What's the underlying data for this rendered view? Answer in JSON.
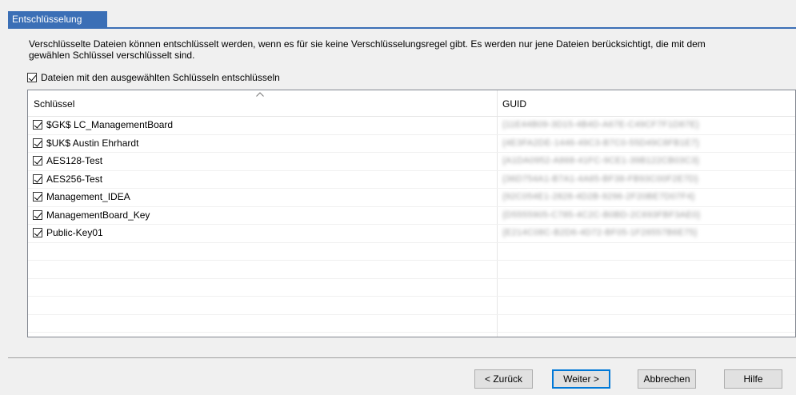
{
  "tab": {
    "title": "Entschlüsselung"
  },
  "description": {
    "line1": "Verschlüsselte Dateien können entschlüsselt werden, wenn es für sie keine Verschlüsselungsregel gibt. Es werden nur jene Dateien berücksichtigt, die mit dem",
    "line2": "gewählen Schlüssel verschlüsselt sind."
  },
  "decrypt_option": {
    "label": "Dateien mit den ausgewählten Schlüsseln entschlüsseln",
    "checked": true
  },
  "table": {
    "columns": {
      "key": "Schlüssel",
      "guid": "GUID"
    },
    "rows": [
      {
        "name": "$GK$ LC_ManagementBoard",
        "guid": "{11E44B09-3D15-4B4D-A67E-C49CF7F1D87E}",
        "checked": true
      },
      {
        "name": "$UK$ Austin Ehrhardt",
        "guid": "{4E3FA2DE-1446-49C3-B7C0-55D49C8FB1E7}",
        "checked": true
      },
      {
        "name": "AES128-Test",
        "guid": "{A1DA0952-A868-41FC-9CE1-39B122CB03C3}",
        "checked": true
      },
      {
        "name": "AES256-Test",
        "guid": "{36D754A1-B7A1-4A65-BF38-FB93C00F2E7D}",
        "checked": true
      },
      {
        "name": "Management_IDEA",
        "guid": "{92C054E1-2828-4D2B-9296-2F20BE7D07F4}",
        "checked": true
      },
      {
        "name": "ManagementBoard_Key",
        "guid": "{D5555905-C785-4C2C-B0BD-2C693FBF3AE0}",
        "checked": true
      },
      {
        "name": "Public-Key01",
        "guid": "{E214C08C-B2D6-4D72-BF05-1F26557B6E75}",
        "checked": true
      }
    ]
  },
  "buttons": {
    "back": "< Zurück",
    "next": "Weiter >",
    "cancel": "Abbrechen",
    "help": "Hilfe"
  }
}
